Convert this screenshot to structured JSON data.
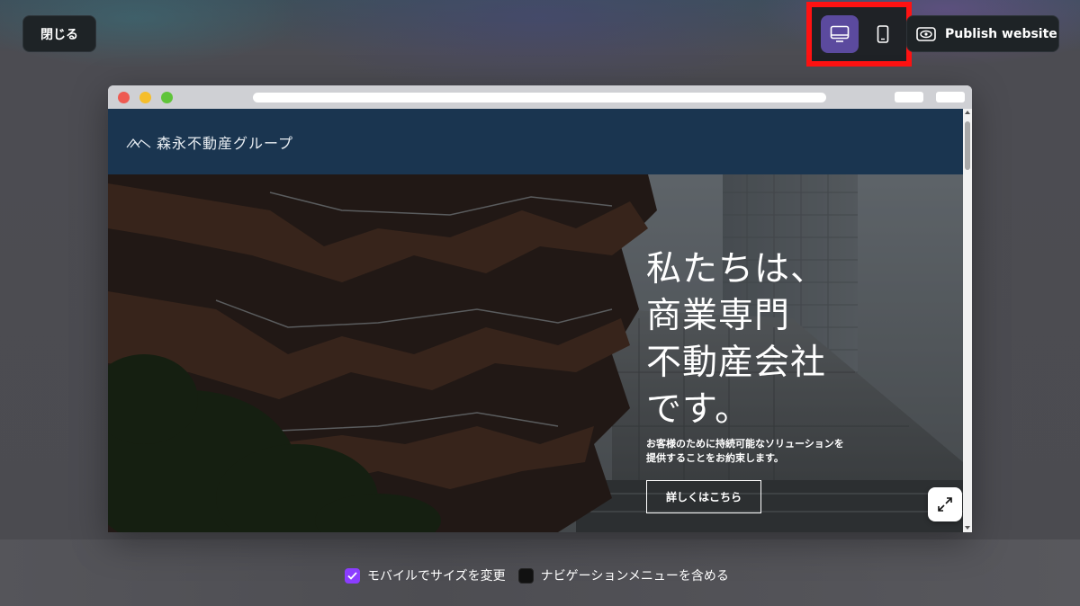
{
  "topbar": {
    "close_label": "閉じる",
    "publish_label": "Publish website",
    "device_toggle": {
      "options": [
        "desktop",
        "mobile"
      ],
      "selected": "desktop",
      "highlight_color": "#ff1212",
      "active_color": "#5b4a9e"
    }
  },
  "site": {
    "brand_name": "森永不動産グループ",
    "hero": {
      "title": "私たちは、\n商業専門\n不動産会社\nです。",
      "subtitle": "お客様のために持続可能なソリューションを\n提供することをお約束します。",
      "cta_label": "詳しくはこちら"
    },
    "header_color": "#1a3550"
  },
  "options": {
    "items": [
      {
        "label": "モバイルでサイズを変更",
        "checked": true
      },
      {
        "label": "ナビゲーションメニューを含める",
        "checked": false
      }
    ],
    "check_color": "#8b3dff"
  },
  "icons": [
    "desktop-icon",
    "mobile-icon",
    "publish-icon",
    "mountain-logo-icon",
    "expand-icon",
    "check-icon"
  ]
}
